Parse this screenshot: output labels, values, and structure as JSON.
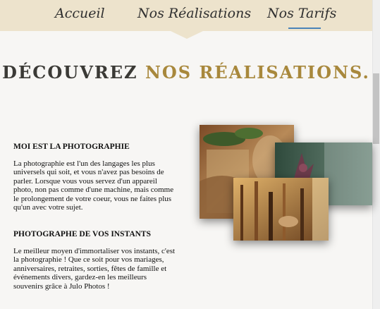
{
  "nav": {
    "items": [
      {
        "label": "Accueil"
      },
      {
        "label": "Nos Réalisations"
      },
      {
        "label": "Nos Tarifs"
      }
    ]
  },
  "page": {
    "title_dark": "DÉCOUVREZ",
    "title_gold": "NOS RÉALISATIONS."
  },
  "sections": [
    {
      "heading": "MOI EST LA PHOTOGRAPHIE",
      "text": "La photographie est l'un des langages les plus universels qui soit, et vous n'avez pas besoins de parler. Lorsque vous vous servez d'un appareil photo, non pas comme d'une machine, mais comme le prolongement de votre coeur, vous ne faites plus qu'un avec votre sujet."
    },
    {
      "heading": "PHOTOGRAPHE DE VOS INSTANTS",
      "text": "Le meilleur moyen d'immortaliser vos instants, c'est la photographie ! Que ce soit pour vos mariages, anniversaires, retraites, sorties, fêtes de famille et événements divers, gardez-en les meilleurs souvenirs grâce à Julo Photos !"
    }
  ],
  "colors": {
    "nav_bg": "#ede3cc",
    "title_dark": "#3b3a36",
    "title_gold": "#a8883c",
    "active_underline": "#4a83b8"
  }
}
